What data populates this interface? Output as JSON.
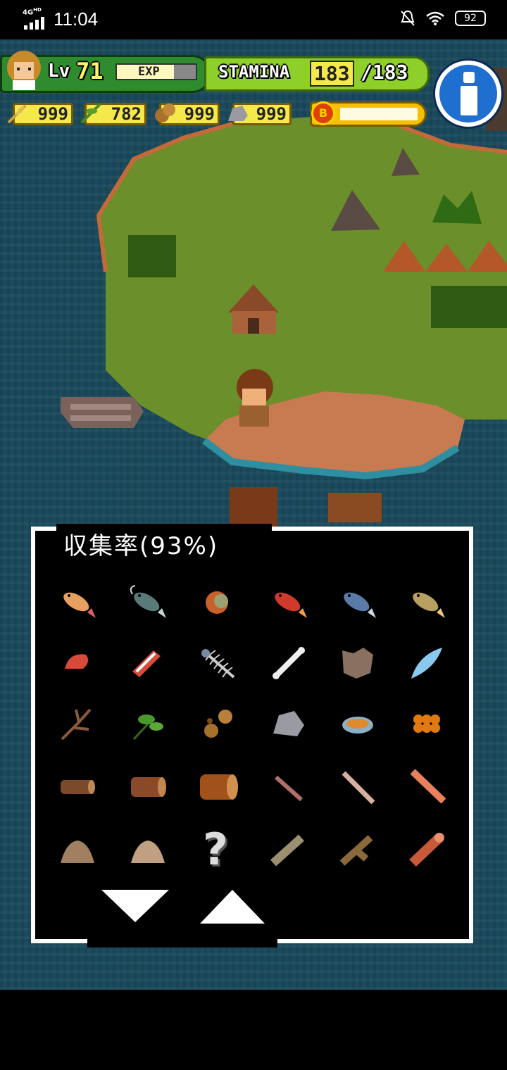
{
  "status_bar": {
    "time": "11:04",
    "network": "4G",
    "network_sup": "HD",
    "battery": "92",
    "icons": [
      "signal-icon",
      "mute-bell-icon",
      "wifi-icon",
      "battery-icon"
    ]
  },
  "hud": {
    "level_label": "Lv",
    "level": "71",
    "exp_label": "EXP",
    "exp_progress": 0.72,
    "stamina_label": "STAMINA",
    "stamina_current": "183",
    "stamina_max": "/183",
    "resources": [
      {
        "icon": "wheat-icon",
        "value": "999"
      },
      {
        "icon": "herb-icon",
        "value": "782"
      },
      {
        "icon": "acorn-icon",
        "value": "999"
      },
      {
        "icon": "stone-icon",
        "value": "999"
      }
    ],
    "coin_label": "B",
    "coin_progress": 1.0,
    "info_button_icon": "info-icon"
  },
  "collection": {
    "title": "収集率(93%)",
    "items": [
      "rainbow-trout-icon",
      "catfish-icon",
      "piranha-icon",
      "red-fish-icon",
      "blue-fish-icon",
      "spotted-fish-icon",
      "shrimp-icon",
      "raw-meat-icon",
      "fish-bone-icon",
      "bone-icon",
      "animal-hide-icon",
      "feather-icon",
      "twig-icon",
      "herb-leaf-icon",
      "acorns-icon",
      "stone-icon",
      "bowl-icon",
      "berries-icon",
      "log-small-icon",
      "log-medium-icon",
      "log-large-icon",
      "stick-thin-icon",
      "stick-light-icon",
      "plank-icon",
      "sawdust-pile-icon",
      "sawdust-pile-light-icon",
      "unknown-item",
      "driftwood-icon",
      "branch-icon",
      "red-log-icon"
    ],
    "unknown_glyph": "?",
    "prev_page_icon": "arrow-down-icon",
    "next_page_icon": "arrow-up-icon"
  }
}
